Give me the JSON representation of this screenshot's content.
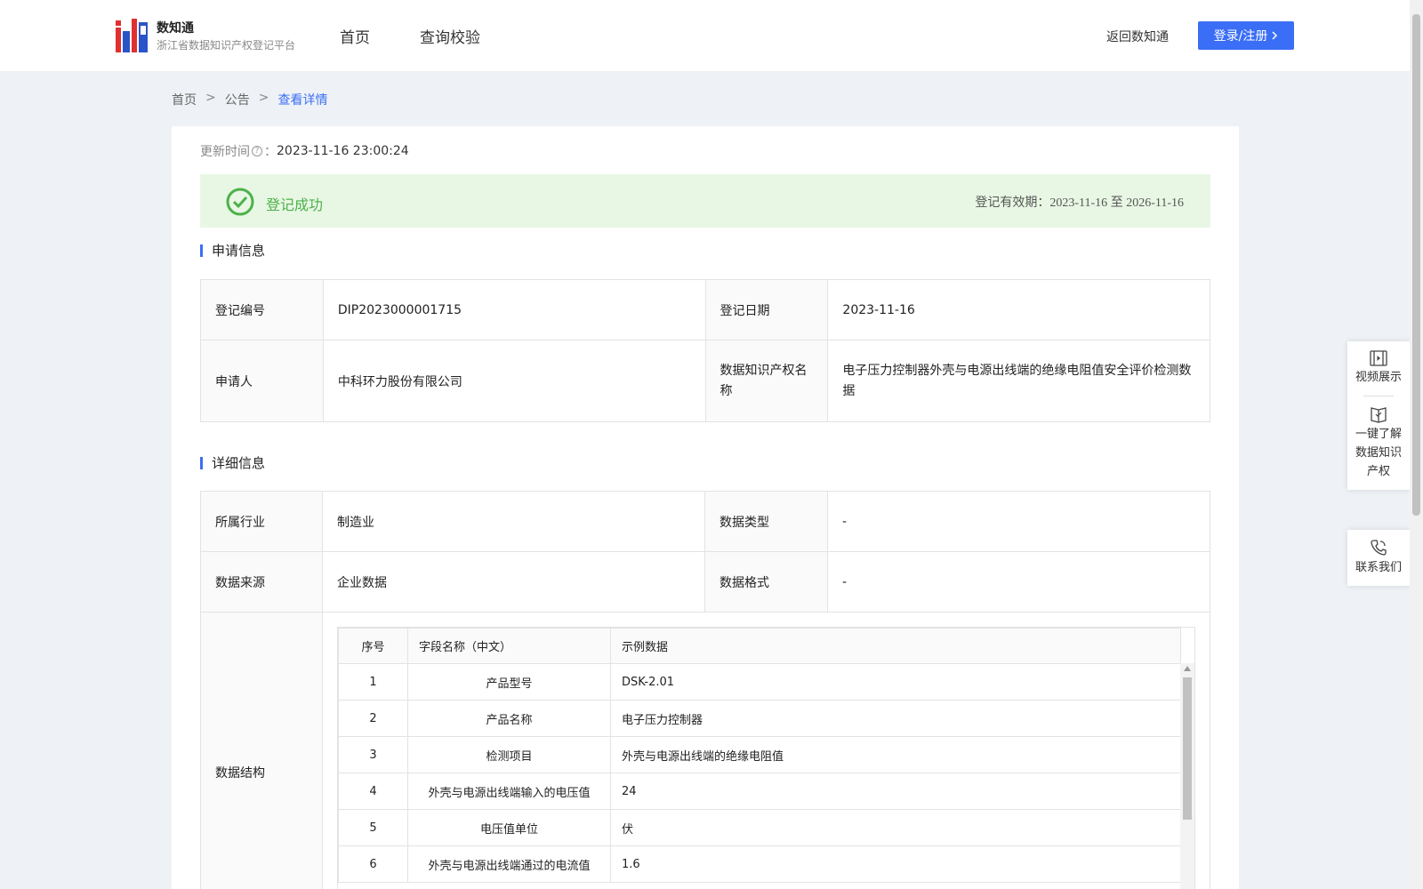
{
  "brand": {
    "name": "数知通",
    "subtitle": "浙江省数据知识产权登记平台"
  },
  "nav": [
    {
      "label": "首页"
    },
    {
      "label": "查询校验"
    }
  ],
  "header": {
    "back_link": "返回数知通",
    "login": "登录/注册"
  },
  "breadcrumb": {
    "home": "首页",
    "sep": ">",
    "notice": "公告",
    "current": "查看详情"
  },
  "update": {
    "label": "更新时间",
    "colon": "：",
    "value": "2023-11-16 23:00:24"
  },
  "status": {
    "text": "登记成功",
    "valid_label": "登记有效期：",
    "valid_from": "2023-11-16",
    "to": "至",
    "valid_to": "2026-11-16"
  },
  "colors": {
    "accent": "#3b6ef6",
    "success": "#4cb14a",
    "success_bg": "#e8f7e4"
  },
  "apply": {
    "title": "申请信息",
    "reg_no_label": "登记编号",
    "reg_no": "DIP2023000001715",
    "reg_date_label": "登记日期",
    "reg_date": "2023-11-16",
    "applicant_label": "申请人",
    "applicant": "中科环力股份有限公司",
    "ip_name_label": "数据知识产权名称",
    "ip_name": "电子压力控制器外壳与电源出线端的绝缘电阻值安全评价检测数据"
  },
  "detail": {
    "title": "详细信息",
    "industry_label": "所属行业",
    "industry": "制造业",
    "data_type_label": "数据类型",
    "data_type": "-",
    "source_label": "数据来源",
    "source": "企业数据",
    "format_label": "数据格式",
    "format": "-",
    "structure_label": "数据结构"
  },
  "fields_table": {
    "headers": {
      "no": "序号",
      "name": "字段名称（中文）",
      "sample": "示例数据"
    },
    "rows": [
      {
        "no": "1",
        "name": "产品型号",
        "sample": "DSK-2.01"
      },
      {
        "no": "2",
        "name": "产品名称",
        "sample": "电子压力控制器"
      },
      {
        "no": "3",
        "name": "检测项目",
        "sample": "外壳与电源出线端的绝缘电阻值"
      },
      {
        "no": "4",
        "name": "外壳与电源出线端输入的电压值",
        "sample": "24"
      },
      {
        "no": "5",
        "name": "电压值单位",
        "sample": "伏"
      },
      {
        "no": "6",
        "name": "外壳与电源出线端通过的电流值",
        "sample": "1.6"
      }
    ]
  },
  "side_panel": {
    "video": "视频展示",
    "learn_1": "一键了解",
    "learn_2": "数据知识",
    "learn_3": "产权",
    "contact": "联系我们"
  }
}
